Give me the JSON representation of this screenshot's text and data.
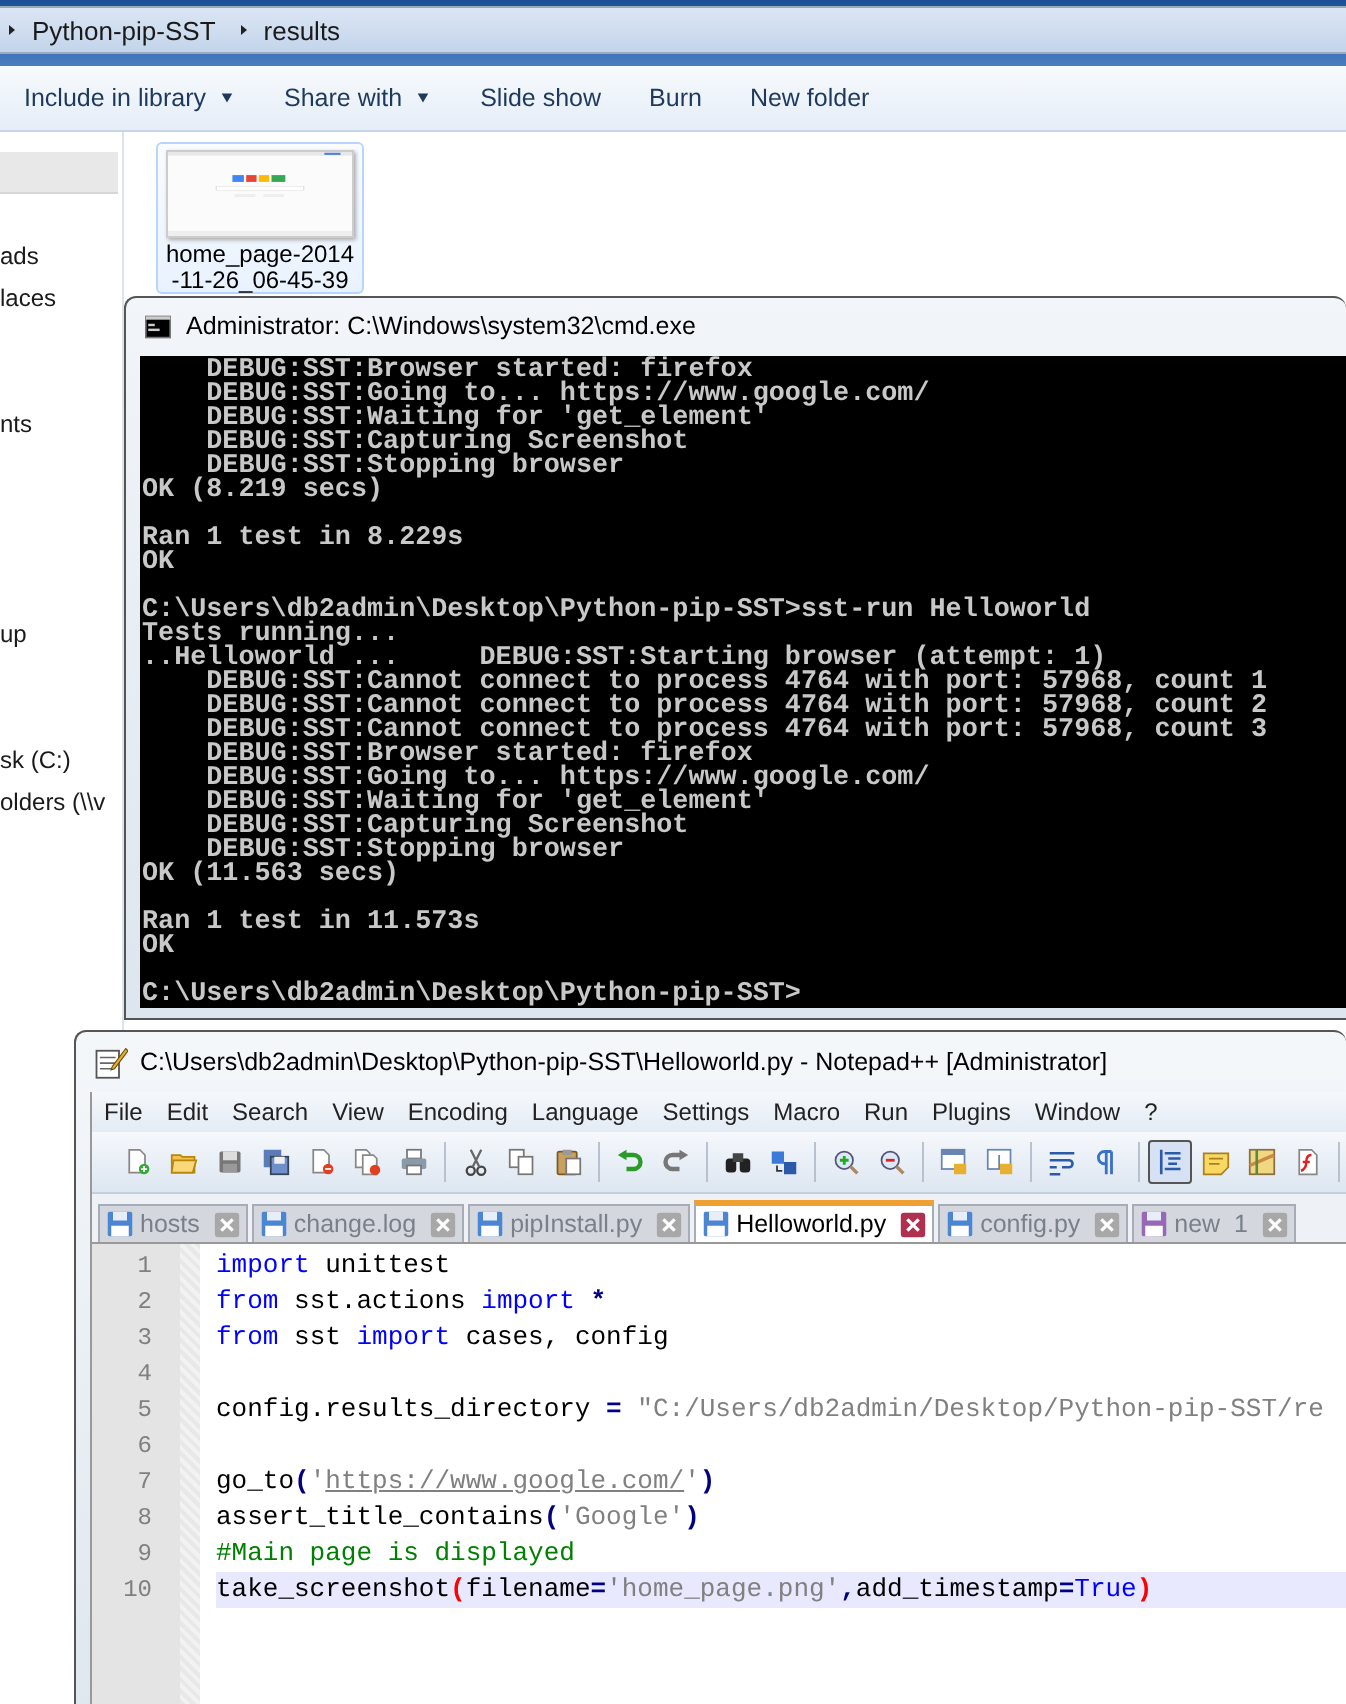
{
  "explorer": {
    "breadcrumb": [
      "Python-pip-SST",
      "results"
    ],
    "toolbar": [
      {
        "label": "Include in library",
        "has_menu": true
      },
      {
        "label": "Share with",
        "has_menu": true
      },
      {
        "label": "Slide show",
        "has_menu": false
      },
      {
        "label": "Burn",
        "has_menu": false
      },
      {
        "label": "New folder",
        "has_menu": false
      }
    ],
    "sidebar_items": [
      "ads",
      "laces",
      "nts",
      "up",
      "sk (C:)",
      "olders (\\\\v"
    ],
    "files": [
      {
        "kind": "picture",
        "label_lines": [
          "home_page-2014",
          "-11-26_06-45-39"
        ],
        "hovered": true
      }
    ]
  },
  "cmd": {
    "title": "Administrator: C:\\Windows\\system32\\cmd.exe",
    "blocks": [
      [
        "    DEBUG:SST:Browser started: firefox",
        "    DEBUG:SST:Going to... https://www.google.com/",
        "    DEBUG:SST:Waiting for 'get_element'",
        "    DEBUG:SST:Capturing Screenshot",
        "    DEBUG:SST:Stopping browser",
        "OK (8.219 secs)"
      ],
      [
        "Ran 1 test in 8.229s",
        "OK"
      ],
      [
        "C:\\Users\\db2admin\\Desktop\\Python-pip-SST>sst-run Helloworld",
        "Tests running...",
        "..Helloworld ...     DEBUG:SST:Starting browser (attempt: 1)",
        "    DEBUG:SST:Cannot connect to process 4764 with port: 57968, count 1",
        "    DEBUG:SST:Cannot connect to process 4764 with port: 57968, count 2",
        "    DEBUG:SST:Cannot connect to process 4764 with port: 57968, count 3",
        "    DEBUG:SST:Browser started: firefox",
        "    DEBUG:SST:Going to... https://www.google.com/",
        "    DEBUG:SST:Waiting for 'get_element'",
        "    DEBUG:SST:Capturing Screenshot",
        "    DEBUG:SST:Stopping browser",
        "OK (11.563 secs)"
      ],
      [
        "Ran 1 test in 11.573s",
        "OK"
      ],
      [
        "C:\\Users\\db2admin\\Desktop\\Python-pip-SST>"
      ]
    ]
  },
  "notepad": {
    "title": "C:\\Users\\db2admin\\Desktop\\Python-pip-SST\\Helloworld.py - Notepad++ [Administrator]",
    "menu": [
      "File",
      "Edit",
      "Search",
      "View",
      "Encoding",
      "Language",
      "Settings",
      "Macro",
      "Run",
      "Plugins",
      "Window",
      "?"
    ],
    "toolbar_buttons": [
      {
        "pressed": false
      },
      {
        "pressed": false
      },
      {
        "pressed": false
      },
      {
        "pressed": false
      },
      {
        "pressed": false
      },
      {
        "pressed": false
      },
      {
        "pressed": false
      },
      {
        "pressed": false
      },
      {
        "pressed": false
      },
      {
        "pressed": false
      },
      {
        "pressed": false
      },
      {
        "pressed": false
      },
      {
        "pressed": false
      },
      {
        "pressed": false
      },
      {
        "pressed": false
      },
      {
        "pressed": false
      },
      {
        "pressed": false
      },
      {
        "pressed": false
      },
      {
        "pressed": false
      },
      {
        "pressed": false
      },
      {
        "pressed": true
      },
      {
        "pressed": false
      },
      {
        "pressed": false
      },
      {
        "pressed": false
      }
    ],
    "tabs": [
      {
        "label": "hosts",
        "selected": false,
        "color": "#4a86d4"
      },
      {
        "label": "change.log",
        "selected": false,
        "color": "#4a86d4"
      },
      {
        "label": "pipInstall.py",
        "selected": false,
        "color": "#4a86d4"
      },
      {
        "label": "Helloworld.py",
        "selected": true,
        "color": "#4a86d4"
      },
      {
        "label": "config.py",
        "selected": false,
        "color": "#4a86d4"
      },
      {
        "label": "new  1",
        "selected": false,
        "color": "#9868b8"
      }
    ],
    "lines": [
      {
        "number": "1",
        "current": false,
        "tokens": [
          {
            "kind": "keyword",
            "text": "import"
          },
          {
            "kind": "plain",
            "text": " unittest"
          }
        ]
      },
      {
        "number": "2",
        "current": false,
        "tokens": [
          {
            "kind": "keyword",
            "text": "from"
          },
          {
            "kind": "plain",
            "text": " sst.actions "
          },
          {
            "kind": "keyword",
            "text": "import"
          },
          {
            "kind": "operator",
            "text": " *"
          }
        ]
      },
      {
        "number": "3",
        "current": false,
        "tokens": [
          {
            "kind": "keyword",
            "text": "from"
          },
          {
            "kind": "plain",
            "text": " sst "
          },
          {
            "kind": "keyword",
            "text": "import"
          },
          {
            "kind": "plain",
            "text": " cases, config"
          }
        ]
      },
      {
        "number": "4",
        "current": false
      },
      {
        "number": "5",
        "current": false,
        "tokens": [
          {
            "kind": "plain",
            "text": "config.results_directory "
          },
          {
            "kind": "operator",
            "text": "="
          },
          {
            "kind": "string",
            "text": " \"C:/Users/db2admin/Desktop/Python-pip-SST/re"
          }
        ]
      },
      {
        "number": "6",
        "current": false
      },
      {
        "number": "7",
        "current": false,
        "tokens": [
          {
            "kind": "plain",
            "text": "go_to"
          },
          {
            "kind": "operator",
            "text": "("
          },
          {
            "kind": "string",
            "text": "'"
          },
          {
            "kind": "link",
            "text": "https://www.google.com/"
          },
          {
            "kind": "string",
            "text": "'"
          },
          {
            "kind": "operator",
            "text": ")"
          }
        ]
      },
      {
        "number": "8",
        "current": false,
        "tokens": [
          {
            "kind": "plain",
            "text": "assert_title_contains"
          },
          {
            "kind": "operator",
            "text": "("
          },
          {
            "kind": "string",
            "text": "'Google'"
          },
          {
            "kind": "operator",
            "text": ")"
          }
        ]
      },
      {
        "number": "9",
        "current": false,
        "tokens": [
          {
            "kind": "comment",
            "text": "#Main page is displayed"
          }
        ]
      },
      {
        "number": "10",
        "current": true,
        "tokens": [
          {
            "kind": "plain",
            "text": "take_screenshot"
          },
          {
            "kind": "brace",
            "text": "("
          },
          {
            "kind": "plain",
            "text": "filename"
          },
          {
            "kind": "operator",
            "text": "="
          },
          {
            "kind": "string",
            "text": "'home_page.png'"
          },
          {
            "kind": "operator",
            "text": ","
          },
          {
            "kind": "plain",
            "text": "add_timestamp"
          },
          {
            "kind": "operator",
            "text": "="
          },
          {
            "kind": "keyword",
            "text": "True"
          },
          {
            "kind": "brace",
            "text": ")"
          }
        ]
      }
    ]
  }
}
